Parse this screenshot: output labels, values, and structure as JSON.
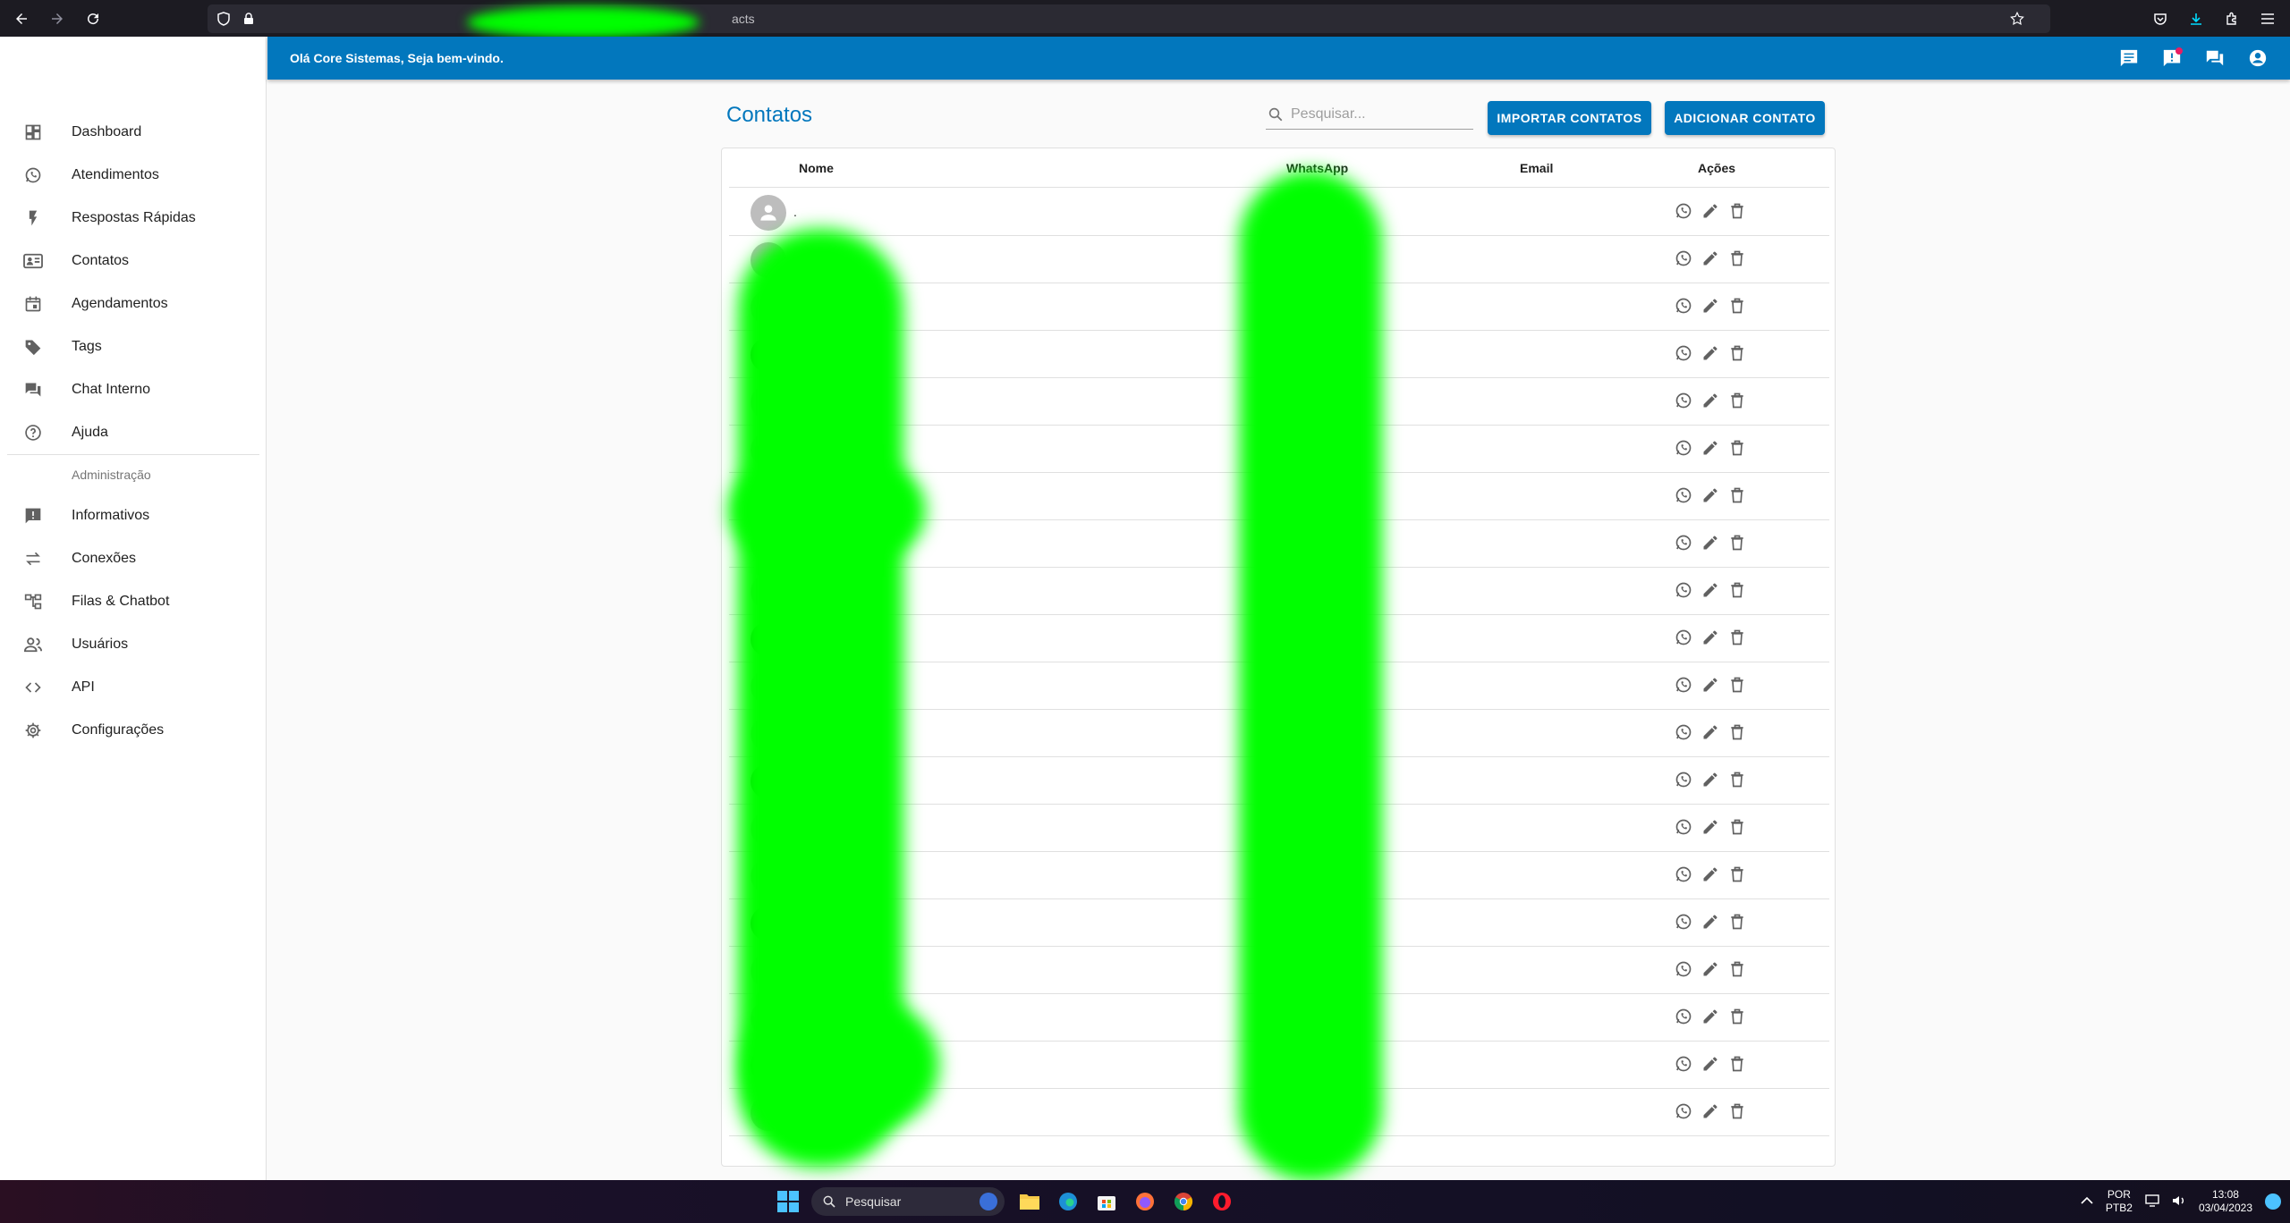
{
  "browser": {
    "url_suffix": "acts"
  },
  "app": {
    "greeting": "Olá Core Sistemas, Seja bem-vindo."
  },
  "sidebar": {
    "items": [
      {
        "label": "Dashboard",
        "icon": "dashboard-icon"
      },
      {
        "label": "Atendimentos",
        "icon": "whatsapp-icon"
      },
      {
        "label": "Respostas Rápidas",
        "icon": "flash-icon"
      },
      {
        "label": "Contatos",
        "icon": "contacts-icon"
      },
      {
        "label": "Agendamentos",
        "icon": "calendar-icon"
      },
      {
        "label": "Tags",
        "icon": "tag-icon"
      },
      {
        "label": "Chat Interno",
        "icon": "forum-icon"
      },
      {
        "label": "Ajuda",
        "icon": "help-icon"
      }
    ],
    "admin_header": "Administração",
    "admin_items": [
      {
        "label": "Informativos",
        "icon": "announcement-icon"
      },
      {
        "label": "Conexões",
        "icon": "swap-icon"
      },
      {
        "label": "Filas & Chatbot",
        "icon": "account-tree-icon"
      },
      {
        "label": "Usuários",
        "icon": "people-icon"
      },
      {
        "label": "API",
        "icon": "code-icon"
      },
      {
        "label": "Configurações",
        "icon": "settings-icon"
      }
    ]
  },
  "main": {
    "title": "Contatos",
    "search_placeholder": "Pesquisar...",
    "import_label": "IMPORTAR CONTATOS",
    "add_label": "ADICIONAR CONTATO",
    "columns": {
      "name": "Nome",
      "whatsapp": "WhatsApp",
      "email": "Email",
      "actions": "Ações"
    },
    "first_row_name": "."
  },
  "taskbar": {
    "search_label": "Pesquisar",
    "lang_top": "POR",
    "lang_bottom": "PTB2",
    "time": "13:08",
    "date": "03/04/2023"
  },
  "colors": {
    "primary": "#0277bd",
    "redaction": "#00ff00"
  }
}
